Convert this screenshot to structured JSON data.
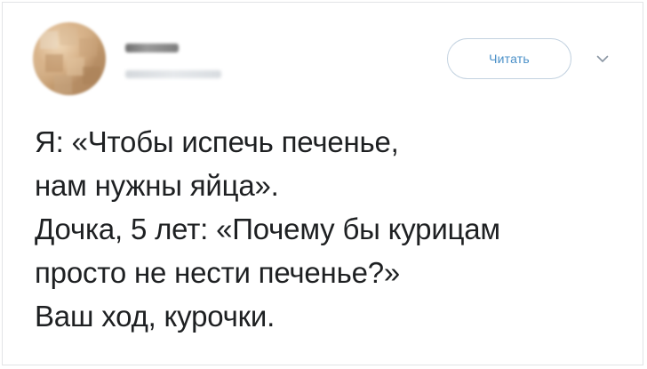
{
  "tweet": {
    "follow_label": "Читать",
    "author_name_redacted": true,
    "lines": [
      "Я: «Чтобы испечь печенье,",
      "нам нужны яйца».",
      "Дочка, 5 лет: «Почему бы курицам",
      "просто не нести печенье?»",
      "Ваш ход, курочки."
    ]
  },
  "icons": {
    "menu": "chevron-down-icon",
    "avatar": "blurred-avatar"
  },
  "colors": {
    "accent": "#4a90c8",
    "text": "#1e2022",
    "border": "#e2e4e6"
  }
}
